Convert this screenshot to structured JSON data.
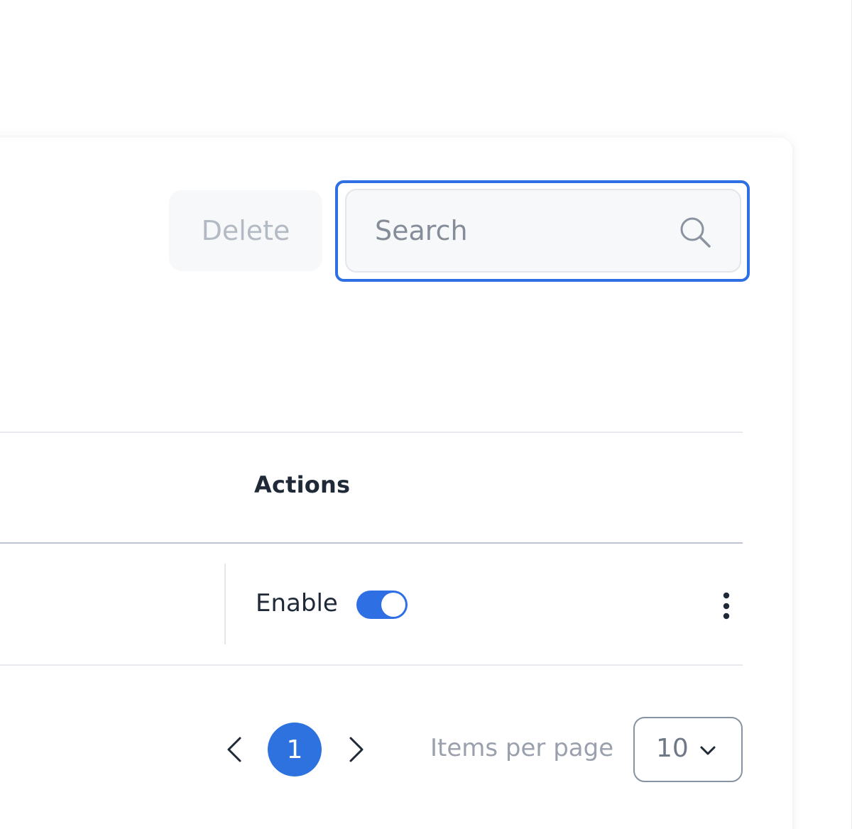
{
  "toolbar": {
    "delete_label": "Delete",
    "search_placeholder": "Search",
    "search_value": ""
  },
  "table": {
    "columns": [
      "Actions"
    ],
    "rows": [
      {
        "action_label": "Enable",
        "enabled": true
      }
    ]
  },
  "pagination": {
    "current_page": "1",
    "items_per_page_label": "Items per page",
    "items_per_page_value": "10"
  },
  "colors": {
    "accent": "#2f6fe4",
    "text_primary": "#1f2937",
    "text_muted": "#9aa1ac"
  },
  "icons": [
    "search-icon",
    "kebab-menu-icon",
    "chevron-left-icon",
    "chevron-right-icon",
    "chevron-down-icon"
  ]
}
